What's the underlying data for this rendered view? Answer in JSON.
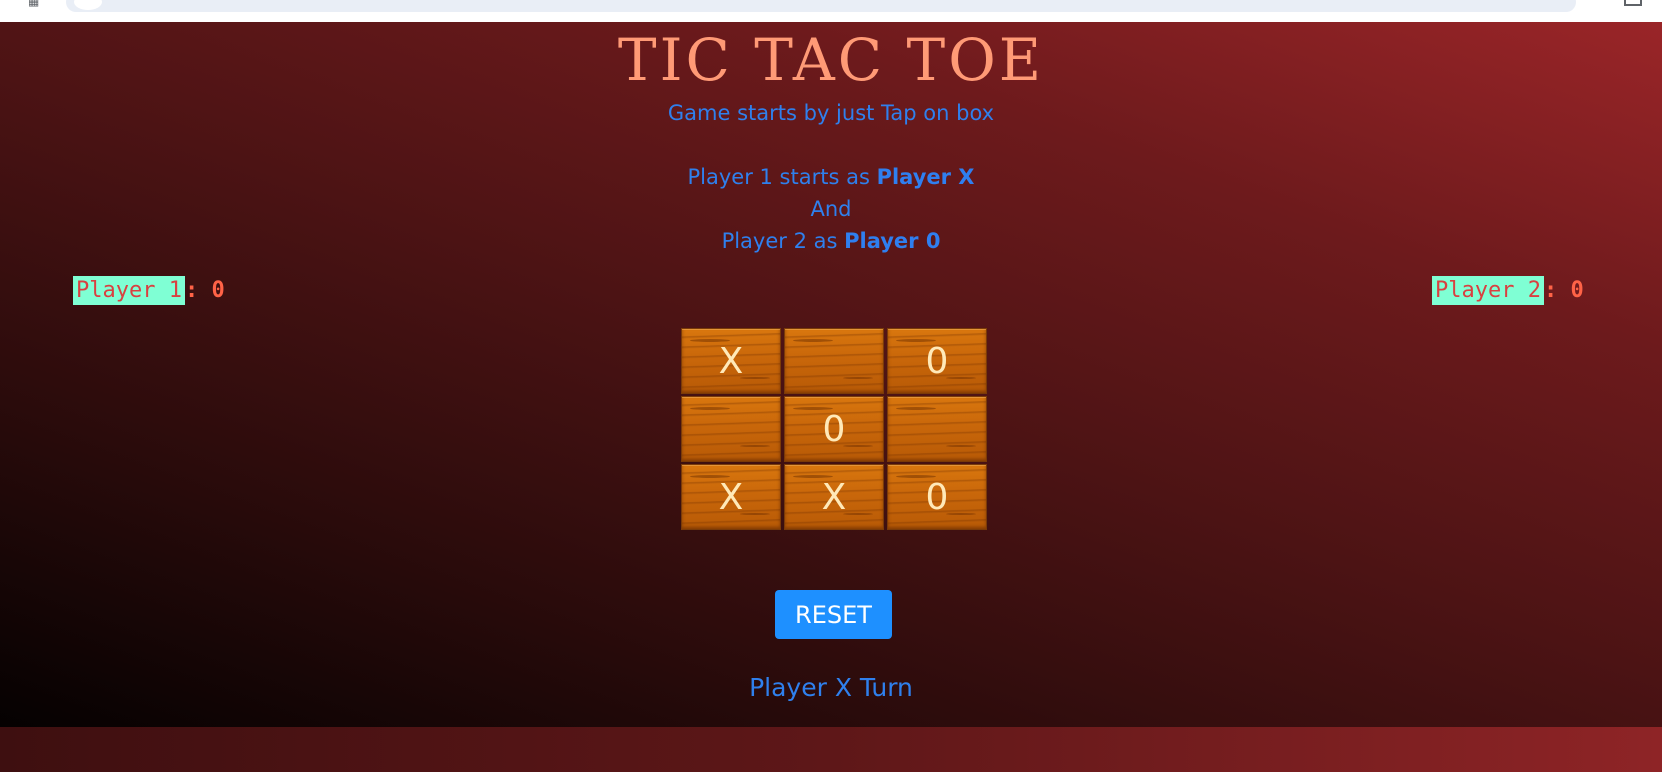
{
  "title": "TIC TAC TOE",
  "subtitle": "Game starts by just Tap on box",
  "info": {
    "line1_prefix": "Player 1 starts as ",
    "line1_bold": "Player X",
    "line2": "And",
    "line3_prefix": "Player 2 as ",
    "line3_bold": "Player 0"
  },
  "scores": {
    "player1": {
      "name": "Player 1",
      "separator": ": ",
      "value": "0"
    },
    "player2": {
      "name": "Player 2",
      "separator": ": ",
      "value": "0"
    }
  },
  "board": {
    "cells": [
      "X",
      "",
      "0",
      "",
      "0",
      "",
      "X",
      "X",
      "0"
    ]
  },
  "reset_label": "RESET",
  "turn_text": "Player X Turn",
  "colors": {
    "title": "#ff9a76",
    "info_text": "#2f80ed",
    "score_name_bg": "#7fffd4",
    "score_name_text": "#d94040",
    "score_value": "#ff6347",
    "reset_bg": "#1e90ff",
    "cell_wood": "#c9670a",
    "cell_mark": "#ffe9b8"
  }
}
